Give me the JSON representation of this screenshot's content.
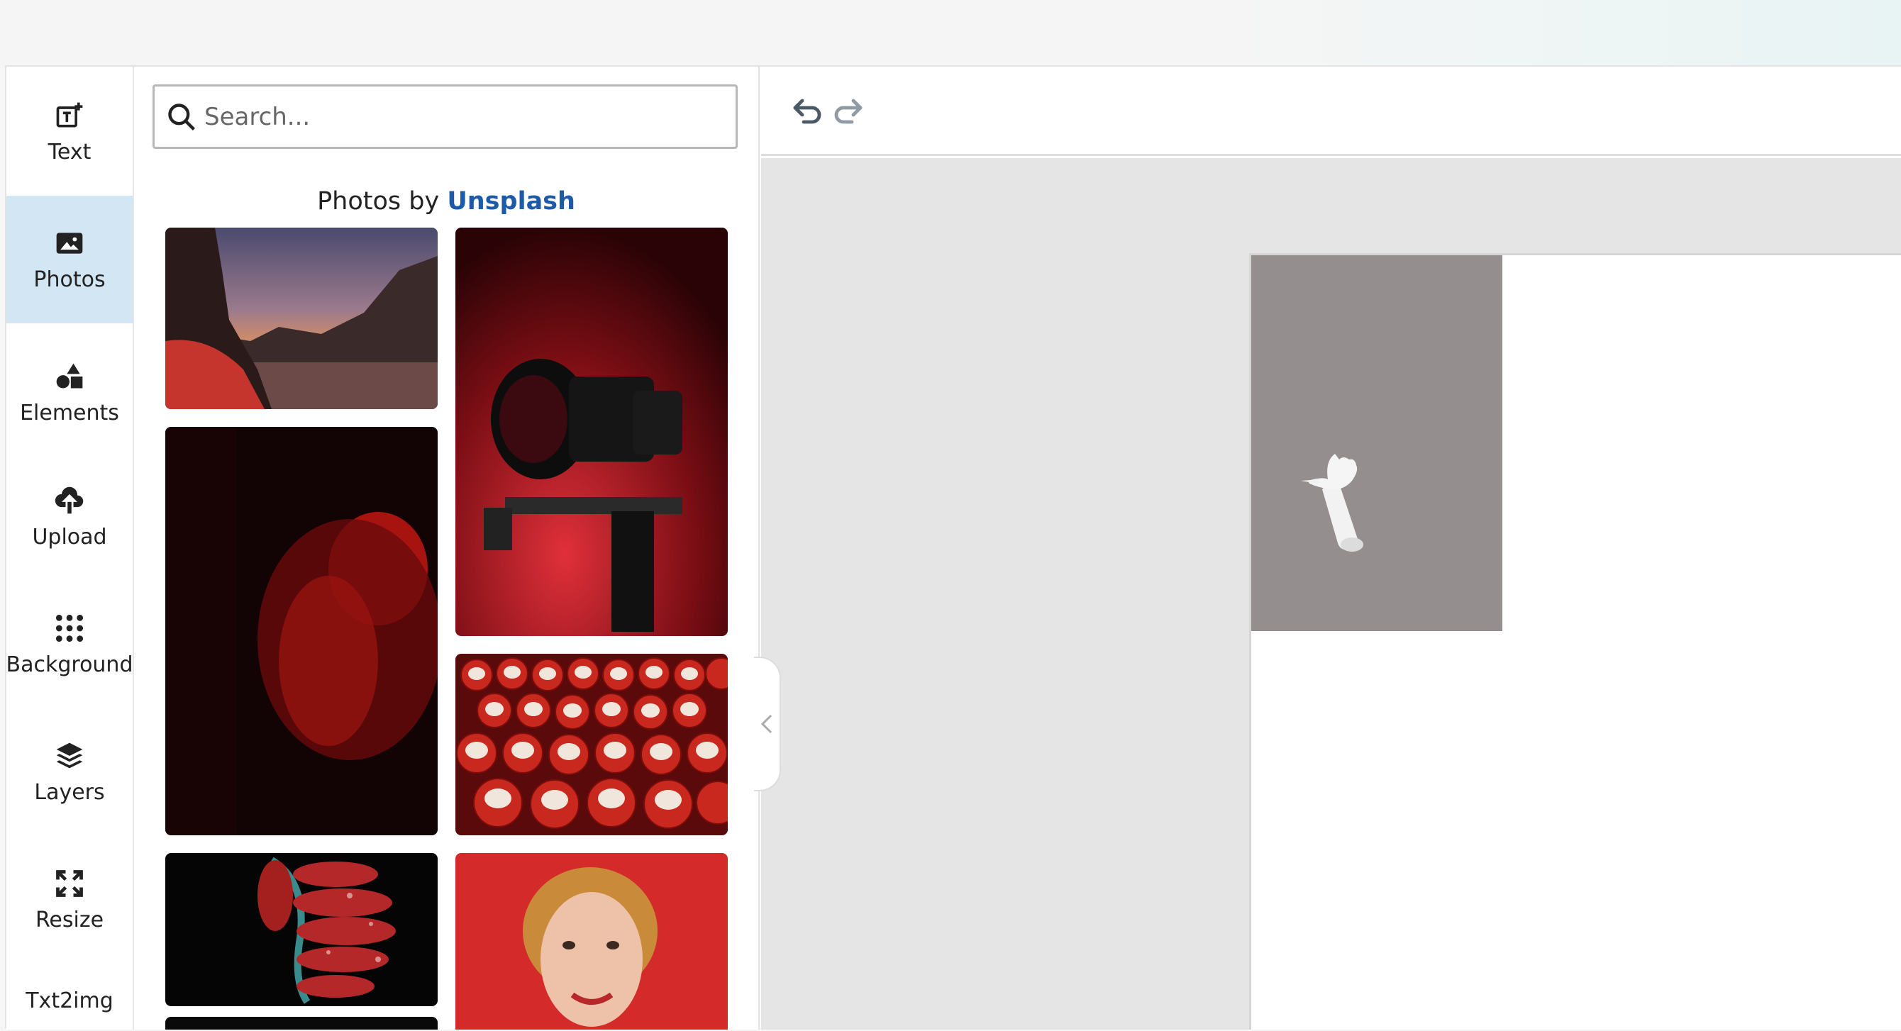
{
  "sidebar": {
    "items": [
      {
        "label": "Text",
        "icon": "add-text-icon",
        "active": false
      },
      {
        "label": "Photos",
        "icon": "image-icon",
        "active": true
      },
      {
        "label": "Elements",
        "icon": "shapes-icon",
        "active": false
      },
      {
        "label": "Upload",
        "icon": "cloud-upload-icon",
        "active": false
      },
      {
        "label": "Background",
        "icon": "dots-grid-icon",
        "active": false
      },
      {
        "label": "Layers",
        "icon": "layers-icon",
        "active": false
      },
      {
        "label": "Resize",
        "icon": "resize-icon",
        "active": false
      },
      {
        "label": "Txt2img",
        "icon": "",
        "active": false
      }
    ],
    "active_color": "#d2e6f4"
  },
  "photos_panel": {
    "search_placeholder": "Search...",
    "credit_prefix": "Photos by",
    "credit_link": "Unsplash",
    "link_color": "#1d5ba8",
    "photos": [
      {
        "subject": "desert-sunset"
      },
      {
        "subject": "red-camera"
      },
      {
        "subject": "red-blurred-figure"
      },
      {
        "subject": "daruma-dolls"
      },
      {
        "subject": "red-fish-skewer"
      },
      {
        "subject": "smiling-woman-red-background"
      }
    ]
  },
  "toolbar": {
    "undo_icon": "undo-icon",
    "redo_icon": "redo-icon"
  },
  "canvas": {
    "background": "#ffffff",
    "workspace_background": "#e5e5e5",
    "element_background": "#948e8f",
    "element_icon": "pointing-hand-icon"
  }
}
